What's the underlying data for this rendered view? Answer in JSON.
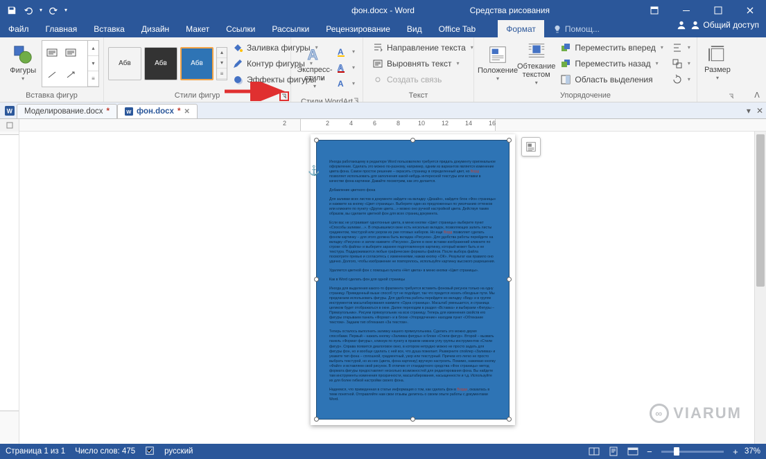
{
  "title_bar": {
    "doc_title": "фон.docx - Word",
    "tools_context": "Средства рисования"
  },
  "menu": {
    "file": "Файл",
    "tabs": [
      "Главная",
      "Вставка",
      "Дизайн",
      "Макет",
      "Ссылки",
      "Рассылки",
      "Рецензирование",
      "Вид",
      "Office Tab"
    ],
    "format": "Формат",
    "tell_me": "Помощ...",
    "share": "Общий доступ"
  },
  "ribbon": {
    "insert_shapes": {
      "label": "Вставка фигур",
      "button": "Фигуры"
    },
    "shape_styles": {
      "label": "Стили фигур",
      "sample_text": "Абв",
      "fill": "Заливка фигуры",
      "outline": "Контур фигуры",
      "effects": "Эффекты фигуры"
    },
    "wordart_styles": {
      "label": "Стили WordArt",
      "button": "Экспресс-стили"
    },
    "text": {
      "label": "Текст",
      "direction": "Направление текста",
      "align": "Выровнять текст",
      "link": "Создать связь"
    },
    "arrange": {
      "label": "Упорядочение",
      "position": "Положение",
      "wrap": "Обтекание текстом",
      "bring_fwd": "Переместить вперед",
      "send_back": "Переместить назад",
      "selection_pane": "Область выделения"
    },
    "size": {
      "label": "Размер",
      "button": "Размер"
    }
  },
  "doc_tabs": {
    "tab1": "Моделирование.docx",
    "tab2": "фон.docx"
  },
  "ruler": {
    "numbers": [
      "2",
      "2",
      "4",
      "6",
      "8",
      "10",
      "12",
      "14",
      "16"
    ]
  },
  "document": {
    "paragraphs": [
      "Иногда работающему в редакторе Word пользователю требуется придать документу оригинальное оформление. Сделать это можно по-разному, например, одним из вариантов является изменение цвета фона. Самое простое решение – окрасить страницу в определенный цвет, но {hl:Ворд} позволяет использовать для заполнения какой-нибудь интересной текстуры или вставки в качестве фона картинки. Давайте посмотрим, как это делается.",
      "Добавление цветного фона",
      "Для заливки всех листов в документе зайдите на вкладку «Дизайн», найдите блок «Фон страницы» и нажмите на кнопку «Цвет страницы». Выберите один из предложенных по умолчанию оттенков или кликните по пункту «Другие цвета…» можно оно ручной настройкой цвета. Действуя таким образом, вы сделаете цветной фон для всех страниц документа.",
      "Если вас не устраивает однотонные цвета, в меню кнопки «Цвет страницы» выберите пункт «Способы заливки…». В открывшемся окне есть несколько вкладок, позволяющих залить листы градиентом, текстурой или узором из уже готовых наборов. Но еще {hl:Ворд} позволяет сделать фоном картинку – для этого должна быть вкладка «Рисунок». Для удобства работы перейдите на вкладку «Рисунок» и затем нажмите «Рисунок». Далее в окне вставки изображений кликните по строке «Из файла» и выберите заранее подготовленную картинку, который может быть и не текстура. Поддерживаются любые графические форматы файлов. После выбора файла посмотрите превью и согласитесь с изменениями, нажав кнопку «ОК». Результат как правило оно удачно. Долгого, чтобы изображение не повторялось, используйте картинку высокого разрешения.",
      "Удаляется цветной фон с помощью пункта «Нет цвета» в меню кнопки «Цвет страницы».",
      "Как в Word сделать фон для одной страницы",
      "Иногда для выделения какого-то фрагмента требуется вставить фоновый рисунок только на одну страницу. Приведенный выше способ тут не подойдет, так что придется искать обходные пути. Мы предлагаем использовать фигуры. Для удобства работы перейдите во вкладку «Вид» и в группе инструментов масштабирования нажмите «Одна страница». Масштаб уменьшится, и страница целиком будет отображаться в окне. Далее переходим в раздел «Вставка» и выбираем «Фигуры – Прямоугольник». Рисуем прямоугольник на всю страницу. Теперь для изменения свойств его фигуры открываем панель «Формат» и в блоке «Упорядочение» находим пункт «Обтекание текстом». Задаем тип обтекания «За текстом».",
      "Теперь осталось выполнить заливку нашего прямоугольника. Сделать это можно двумя способами. Первый – нажать кнопку «Заливка фигуры» в блоке «Стили фигур». Второй – вызвать панель «Формат фигуры», кликнув по пункту в правом нижнем углу группы инструментов «Стили фигур». Справа появится диалоговое окно, в котором нетрудно можно не просто задать для фигуры фон, но и вообще сделать с ней все, что душа пожелает. Разверните спойлер «Заливка» и укажите тип фона – сплошной, градиентный, узор или текстурный. Причем его легко не просто выбрать текстурой, но из них (цвета, фона картинку) вручную настроить. Помимо, нажимаю кнопку «Файл» и вставляем свой рисунок. В отличие от стандартного средства «Фон страницы» метод формата фигуры предоставляет несколько возможностей для редактирования фона. Вы найдете там инструменты изменения прозрачности, масштабирования, насыщенности и т.д. Используйте их для более гибкой настройки своего фона.",
      "Надеемся, что приведенная в статье информация о том, как сделать фон в {hl:Ворде}, оказалась в теме понятной. Отправляйте нам свои отзывы делитесь о своем опыте работы с документами Word."
    ]
  },
  "status": {
    "page": "Страница 1 из 1",
    "words": "Число слов: 475",
    "lang": "русский",
    "zoom": "37%"
  },
  "watermark": "VIARUM"
}
